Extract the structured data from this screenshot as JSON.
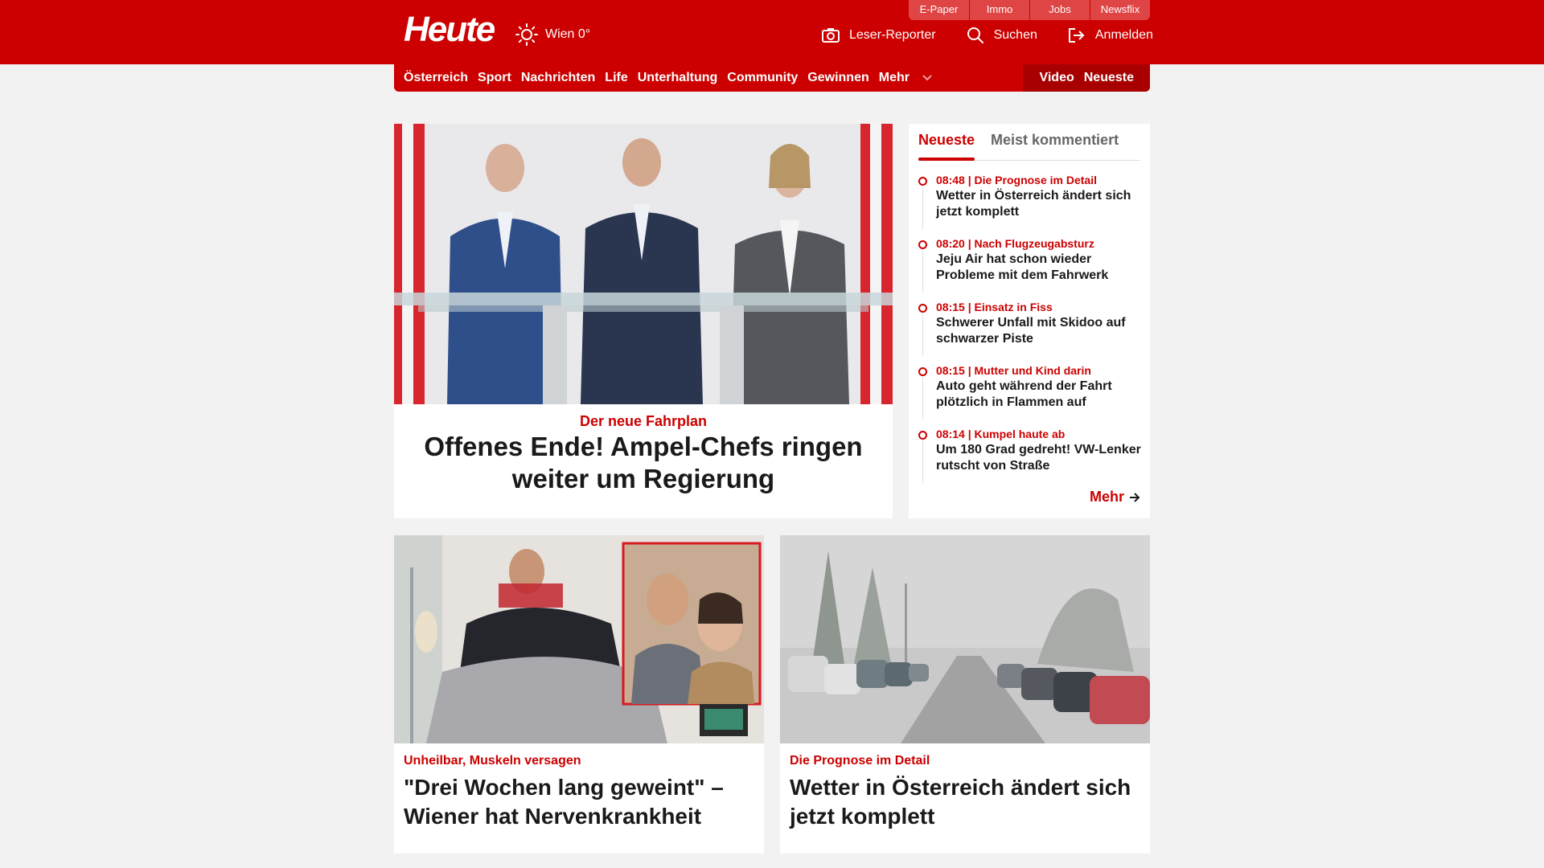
{
  "brand": {
    "logo": "Heute",
    "weather": "Wien 0°"
  },
  "utility_links": [
    "E-Paper",
    "Immo",
    "Jobs",
    "Newsflix"
  ],
  "header_actions": {
    "reporter": "Leser-Reporter",
    "search": "Suchen",
    "login": "Anmelden"
  },
  "nav": {
    "items": [
      "Österreich",
      "Sport",
      "Nachrichten",
      "Life",
      "Unterhaltung",
      "Community",
      "Gewinnen"
    ],
    "more": "Mehr",
    "video": "Video",
    "latest": "Neueste"
  },
  "hero": {
    "kicker": "Der neue Fahrplan",
    "headline": "Offenes Ende! Ampel-Chefs ringen weiter um Regierung"
  },
  "sidebar": {
    "tabs": [
      "Neueste",
      "Meist kommentiert"
    ],
    "items": [
      {
        "meta": "08:48 | Die Prognose im Detail",
        "title": "Wetter in Österreich ändert sich jetzt komplett"
      },
      {
        "meta": "08:20 | Nach Flugzeugabsturz",
        "title": "Jeju Air hat schon wieder Probleme mit dem Fahrwerk"
      },
      {
        "meta": "08:15 | Einsatz in Fiss",
        "title": "Schwerer Unfall mit Skidoo auf schwarzer Piste"
      },
      {
        "meta": "08:15 | Mutter und Kind darin",
        "title": "Auto geht während der Fahrt plötzlich in Flammen auf"
      },
      {
        "meta": "08:14 | Kumpel haute ab",
        "title": "Um 180 Grad gedreht! VW-Lenker rutscht von Straße"
      }
    ],
    "more": "Mehr"
  },
  "cards": [
    {
      "kicker": "Unheilbar, Muskeln versagen",
      "headline": "\"Drei Wochen lang geweint\" – Wiener hat Nervenkrankheit"
    },
    {
      "kicker": "Die Prognose im Detail",
      "headline": "Wetter in Österreich ändert sich jetzt komplett"
    }
  ],
  "colors": {
    "brand_red": "#cc0000",
    "dark_red": "#a80000",
    "background": "#f2f2f2"
  }
}
